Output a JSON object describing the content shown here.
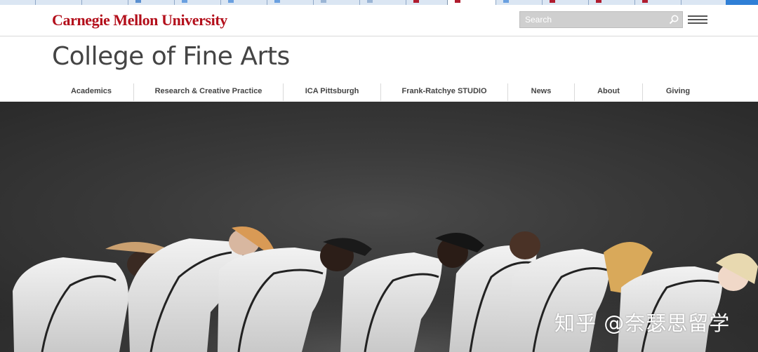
{
  "header": {
    "logo_text": "Carnegie Mellon University",
    "logo_color": "#b30f1b",
    "search_placeholder": "Search"
  },
  "site": {
    "title": "College of Fine Arts"
  },
  "nav": {
    "items": [
      {
        "label": "Academics"
      },
      {
        "label": "Research & Creative Practice"
      },
      {
        "label": "ICA Pittsburgh"
      },
      {
        "label": "Frank-Ratchye STUDIO"
      },
      {
        "label": "News"
      },
      {
        "label": "About"
      },
      {
        "label": "Giving"
      }
    ]
  },
  "hero": {
    "image_subject": "dancers in white bodysuits bending forward in a line",
    "watermark": "知乎 @奈瑟思留学"
  },
  "colors": {
    "brand_red": "#b30f1b",
    "tab_active_accent": "#2f7fd6"
  }
}
